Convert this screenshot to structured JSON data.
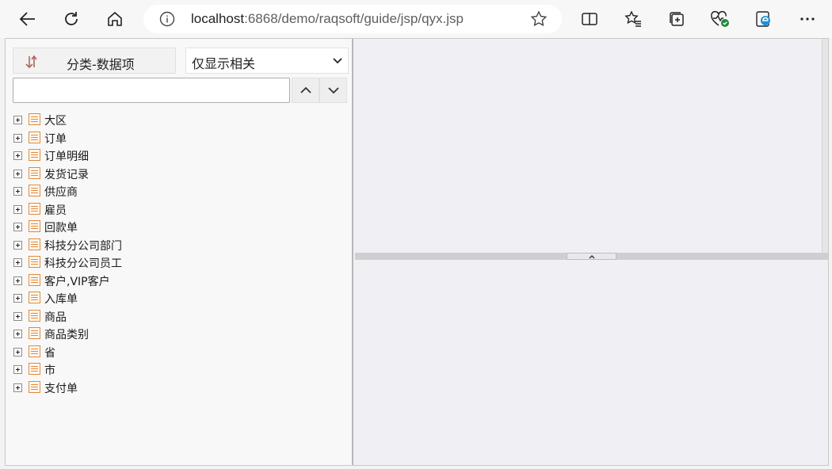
{
  "browser": {
    "url_host": "localhost",
    "url_rest": ":6868/demo/raqsoft/guide/jsp/qyx.jsp"
  },
  "left_pane": {
    "sort_button_label": "分类-数据项",
    "filter_select_value": "仅显示相关",
    "search_placeholder": "",
    "tree_items": [
      "大区",
      "订单",
      "订单明细",
      "发货记录",
      "供应商",
      "雇员",
      "回款单",
      "科技分公司部门",
      "科技分公司员工",
      "客户,VIP客户",
      "入库单",
      "商品",
      "商品类别",
      "省",
      "市",
      "支付单"
    ]
  },
  "colors": {
    "table_icon": "#e08a3c",
    "sort_icon": "#b0675a"
  }
}
